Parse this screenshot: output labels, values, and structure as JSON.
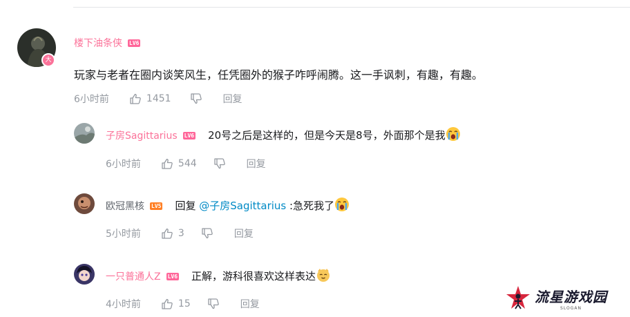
{
  "comment": {
    "username": "楼下油条侠",
    "username_color": "#fb7299",
    "level": "LV6",
    "level_color": "#ff6699",
    "avatar_badge": "大",
    "text": "玩家与老者在圈内谈笑风生，任凭圈外的猴子咋呼闹腾。这一手讽刺，有趣，有趣。",
    "time": "6小时前",
    "likes": "1451",
    "reply_label": "回复"
  },
  "replies": [
    {
      "username": "子房Sagittarius",
      "username_color": "#fb7299",
      "level": "LV6",
      "level_color": "#ff6699",
      "text": "20号之后是这样的，但是今天是8号，外面那个是我",
      "emoji": "crying-face-emoji",
      "time": "6小时前",
      "likes": "544",
      "reply_label": "回复"
    },
    {
      "username": "欧冠黑核",
      "username_color": "#61666d",
      "level": "LV5",
      "level_color": "#ff7f24",
      "reply_prefix": "回复 ",
      "mention": "@子房Sagittarius",
      "text": ":急死我了",
      "emoji": "crying-face-emoji",
      "time": "5小时前",
      "likes": "3",
      "reply_label": "回复"
    },
    {
      "username": "一只普通人Z",
      "username_color": "#fb7299",
      "level": "LV6",
      "level_color": "#ff6699",
      "text": "正解，游科很喜欢这样表达",
      "emoji": "smug-cat-emoji",
      "time": "4小时前",
      "likes": "15",
      "reply_label": "回复"
    }
  ],
  "watermark": {
    "title": "流星游戏园",
    "slogan": "SLOGAN",
    "logo_icon": "star-person-logo"
  }
}
